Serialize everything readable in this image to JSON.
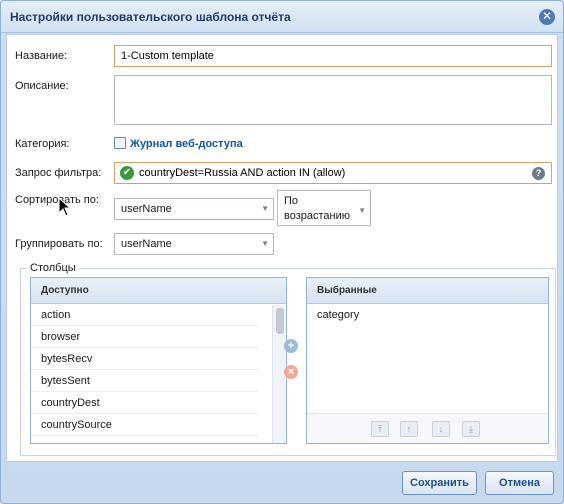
{
  "dialog": {
    "title": "Настройки пользовательского шаблона отчёта",
    "close_glyph": "✕"
  },
  "form": {
    "name_label": "Название:",
    "name_value": "1-Custom template",
    "description_label": "Описание:",
    "description_value": "",
    "category_label": "Категория:",
    "category_value": "Журнал веб-доступа",
    "filter_label": "Запрос фильтра:",
    "filter_value": "countryDest=Russia AND action IN (allow)",
    "sort_label": "Сортировать по:",
    "sort_field": "userName",
    "sort_direction": "По возрастанию",
    "group_label": "Группировать по:",
    "group_field": "userName"
  },
  "columns": {
    "legend": "Столбцы",
    "available_header": "Доступно",
    "available": [
      "action",
      "browser",
      "bytesRecv",
      "bytesSent",
      "countryDest",
      "countrySource"
    ],
    "selected_header": "Выбранные",
    "selected": [
      "category"
    ]
  },
  "buttons": {
    "save": "Сохранить",
    "cancel": "Отмена"
  },
  "icons": {
    "filter_status": "check-circle-icon",
    "help": "help-icon",
    "add": "plus-icon",
    "remove": "close-icon"
  }
}
